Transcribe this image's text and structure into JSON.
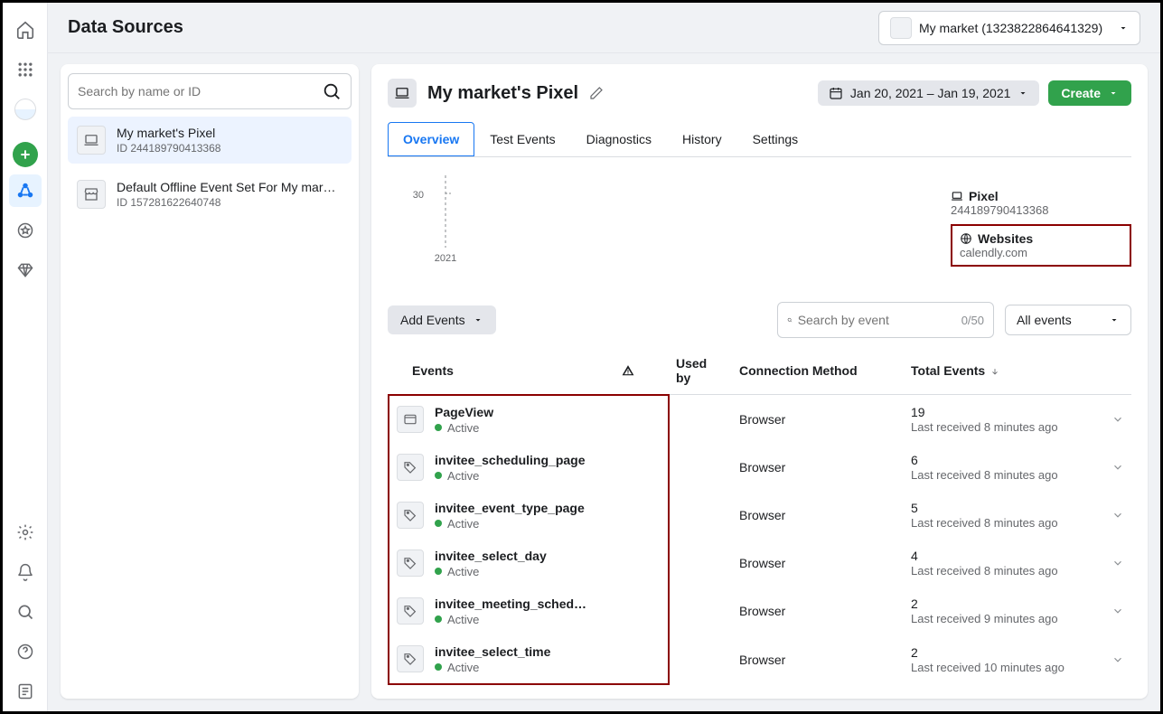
{
  "page": {
    "title": "Data Sources"
  },
  "account": {
    "label": "My market (1323822864641329)"
  },
  "sidebar": {
    "search_placeholder": "Search by name or ID",
    "sources": [
      {
        "name": "My market's Pixel",
        "id_label": "ID 244189790413368",
        "icon": "laptop",
        "selected": true
      },
      {
        "name": "Default Offline Event Set For My mar…",
        "id_label": "ID 157281622640748",
        "icon": "store",
        "selected": false
      }
    ]
  },
  "detail": {
    "title": "My market's Pixel",
    "date_range": "Jan 20, 2021 – Jan 19, 2021",
    "create_label": "Create",
    "tabs": [
      {
        "label": "Overview",
        "active": true
      },
      {
        "label": "Test Events"
      },
      {
        "label": "Diagnostics"
      },
      {
        "label": "History"
      },
      {
        "label": "Settings"
      }
    ],
    "info": {
      "pixel_label": "Pixel",
      "pixel_id": "244189790413368",
      "websites_label": "Websites",
      "website_value": "calendly.com"
    }
  },
  "events_section": {
    "add_events_label": "Add Events",
    "search_placeholder": "Search by event",
    "counter": "0/50",
    "filter_label": "All events",
    "columns": {
      "events": "Events",
      "usedby": "Used by",
      "method": "Connection Method",
      "total": "Total Events"
    }
  },
  "events": [
    {
      "name": "PageView",
      "status": "Active",
      "method": "Browser",
      "count": "19",
      "received": "Last received 8 minutes ago",
      "icon": "window"
    },
    {
      "name": "invitee_scheduling_page",
      "status": "Active",
      "method": "Browser",
      "count": "6",
      "received": "Last received 8 minutes ago",
      "icon": "tag"
    },
    {
      "name": "invitee_event_type_page",
      "status": "Active",
      "method": "Browser",
      "count": "5",
      "received": "Last received 8 minutes ago",
      "icon": "tag"
    },
    {
      "name": "invitee_select_day",
      "status": "Active",
      "method": "Browser",
      "count": "4",
      "received": "Last received 8 minutes ago",
      "icon": "tag"
    },
    {
      "name": "invitee_meeting_sched…",
      "status": "Active",
      "method": "Browser",
      "count": "2",
      "received": "Last received 9 minutes ago",
      "icon": "tag"
    },
    {
      "name": "invitee_select_time",
      "status": "Active",
      "method": "Browser",
      "count": "2",
      "received": "Last received 10 minutes ago",
      "icon": "tag"
    }
  ],
  "chart_data": {
    "type": "line",
    "title": "",
    "x": [
      "2021"
    ],
    "y_ticks": [
      30
    ],
    "series": [],
    "ylabel": "",
    "xlabel": ""
  }
}
